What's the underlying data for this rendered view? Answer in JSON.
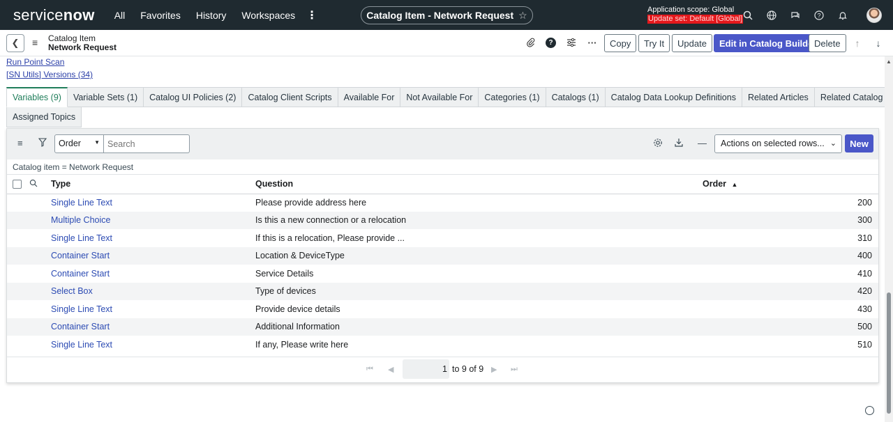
{
  "topnav": {
    "logo": "servicenow",
    "links": [
      "All",
      "Favorites",
      "History",
      "Workspaces"
    ],
    "more": "⋮",
    "record_title": "Catalog Item - Network Request",
    "scope_line": "Application scope: Global",
    "update_set": "Update set: Default [Global]"
  },
  "form": {
    "title_line1": "Catalog Item",
    "title_line2": "Network Request",
    "buttons": {
      "copy": "Copy",
      "try_it": "Try It",
      "update": "Update",
      "builder": "Edit in Catalog Builder",
      "delete": "Delete"
    },
    "help": "?"
  },
  "related_links": [
    "Run Point Scan",
    "[SN Utils] Versions (34)"
  ],
  "tabs": [
    "Variables (9)",
    "Variable Sets (1)",
    "Catalog UI Policies (2)",
    "Catalog Client Scripts",
    "Available For",
    "Not Available For",
    "Categories (1)",
    "Catalogs (1)",
    "Catalog Data Lookup Definitions",
    "Related Articles",
    "Related Catalog Items",
    "Assigned Topics"
  ],
  "list": {
    "filter_field": "Order",
    "search_placeholder": "Search",
    "actions": "Actions on selected rows...",
    "new_label": "New",
    "breadcrumb": "Catalog item = Network Request",
    "columns": {
      "type": "Type",
      "question": "Question",
      "order": "Order"
    },
    "sort_indicator": "▲",
    "rows": [
      {
        "type": "Single Line Text",
        "question": "Please provide address here",
        "order": "200"
      },
      {
        "type": "Multiple Choice",
        "question": "Is this a new connection or a relocation",
        "order": "300"
      },
      {
        "type": "Single Line Text",
        "question": "If this is a relocation, Please provide ...",
        "order": "310"
      },
      {
        "type": "Container Start",
        "question": "Location & DeviceType",
        "order": "400"
      },
      {
        "type": "Container Start",
        "question": "Service Details",
        "order": "410"
      },
      {
        "type": "Select Box",
        "question": "Type of devices",
        "order": "420"
      },
      {
        "type": "Single Line Text",
        "question": "Provide device details",
        "order": "430"
      },
      {
        "type": "Container Start",
        "question": "Additional Information",
        "order": "500"
      },
      {
        "type": "Single Line Text",
        "question": "If any, Please write here",
        "order": "510"
      }
    ],
    "pager": {
      "page": "1",
      "range": "to 9 of 9"
    }
  },
  "colors": {
    "nav_bg": "#1f2a30",
    "primary": "#4a57c8",
    "active_tab": "#1f7d5a",
    "link": "#2c4bb3",
    "update_set_bg": "#e4181c"
  }
}
